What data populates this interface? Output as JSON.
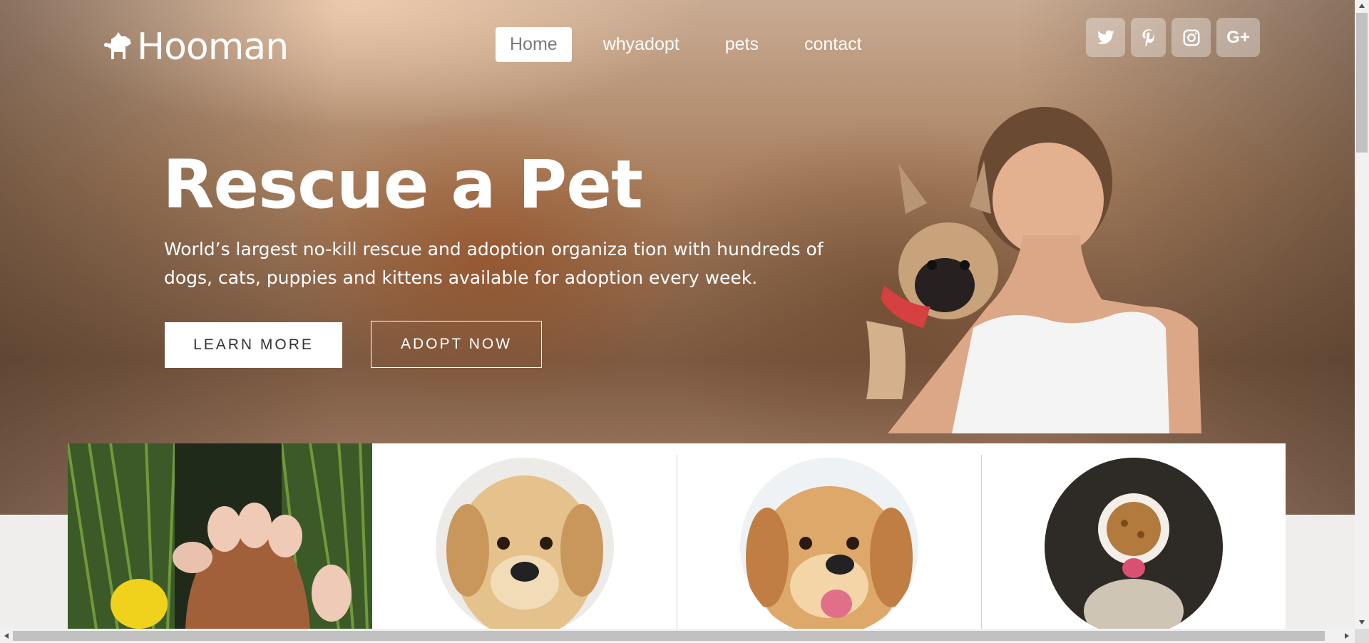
{
  "brand": {
    "name": "Hooman",
    "logo_icon": "dog-icon"
  },
  "nav": {
    "items": [
      {
        "label": "Home",
        "active": true
      },
      {
        "label": "whyadopt",
        "active": false
      },
      {
        "label": "pets",
        "active": false
      },
      {
        "label": "contact",
        "active": false
      }
    ]
  },
  "social": [
    {
      "icon": "twitter-icon"
    },
    {
      "icon": "pinterest-icon"
    },
    {
      "icon": "instagram-icon"
    },
    {
      "icon": "google-plus-icon",
      "label": "G+"
    }
  ],
  "hero": {
    "title": "Rescue a Pet",
    "subtitle": "World’s largest no-kill rescue and adoption organiza tion with hundreds of dogs, cats, puppies and kittens available for adoption every week.",
    "buttons": {
      "learn_more": "LEARN MORE",
      "adopt_now": "ADOPT NOW"
    },
    "image": "boy-hugging-puppy-photo"
  },
  "cards": [
    {
      "image": "hand-holding-paw-photo"
    },
    {
      "image": "golden-puppy-photo"
    },
    {
      "image": "happy-golden-dog-photo"
    },
    {
      "image": "cat-food-bowl-photo"
    }
  ],
  "colors": {
    "nav_active_bg": "#ffffff",
    "nav_active_text": "#7a7a7a",
    "card_bg": "#ffffff",
    "page_bg": "#efeeec"
  }
}
